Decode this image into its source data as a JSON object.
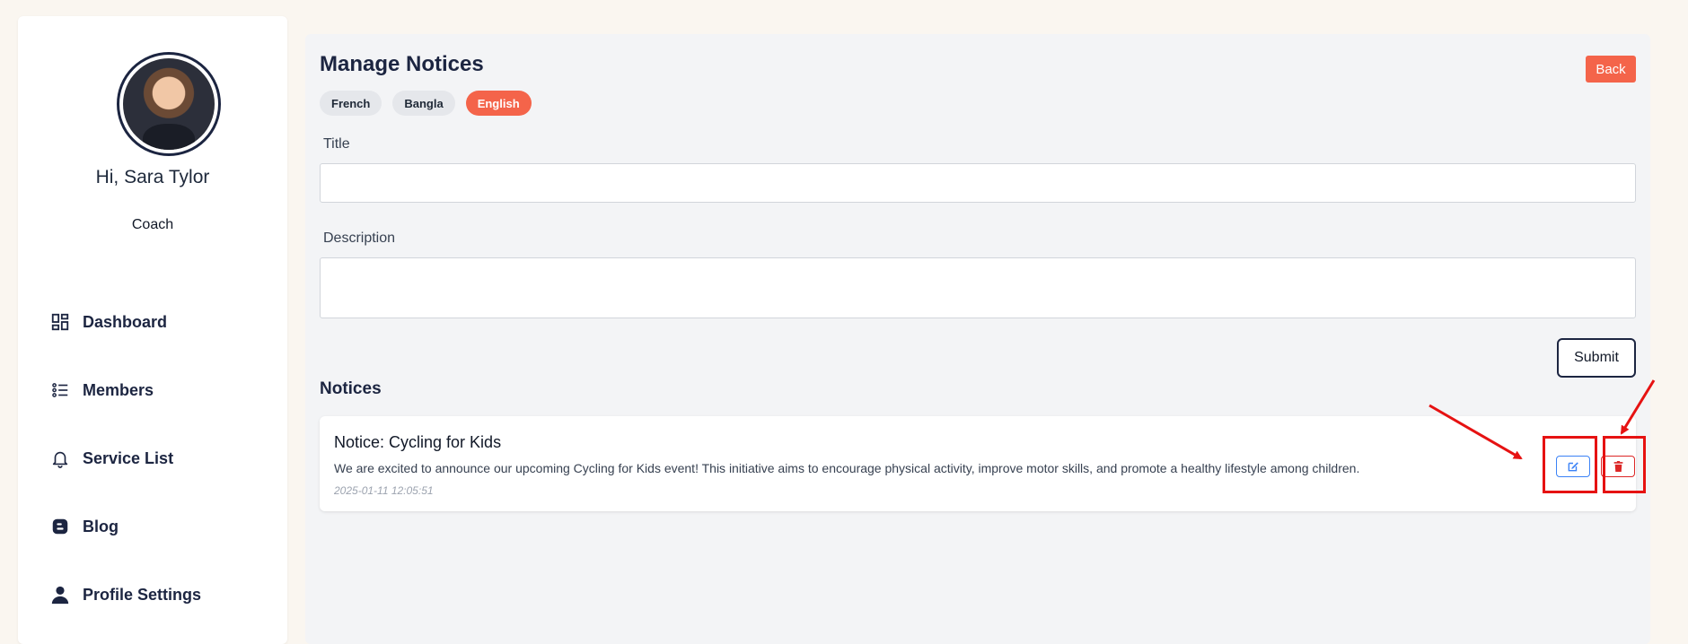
{
  "sidebar": {
    "greeting": "Hi, Sara Tylor",
    "role": "Coach",
    "items": [
      {
        "label": "Dashboard",
        "icon": "dashboard-icon"
      },
      {
        "label": "Members",
        "icon": "list-icon"
      },
      {
        "label": "Service List",
        "icon": "bell-icon"
      },
      {
        "label": "Blog",
        "icon": "blog-icon"
      },
      {
        "label": "Profile Settings",
        "icon": "user-icon"
      }
    ]
  },
  "main": {
    "title": "Manage Notices",
    "back_label": "Back",
    "languages": [
      {
        "label": "French",
        "active": false
      },
      {
        "label": "Bangla",
        "active": false
      },
      {
        "label": "English",
        "active": true
      }
    ],
    "form": {
      "title_label": "Title",
      "title_value": "",
      "description_label": "Description",
      "description_value": "",
      "submit_label": "Submit"
    },
    "notices_heading": "Notices",
    "notices": [
      {
        "title": "Notice: Cycling for Kids",
        "description": "We are excited to announce our upcoming Cycling for Kids event! This initiative aims to encourage physical activity, improve motor skills, and promote a healthy lifestyle among children.",
        "date": "2025-01-11 12:05:51"
      }
    ]
  },
  "colors": {
    "accent": "#f4644a",
    "navy": "#1c2541",
    "edit": "#3b82f6",
    "delete": "#dc2626",
    "annotation": "#e61212"
  }
}
